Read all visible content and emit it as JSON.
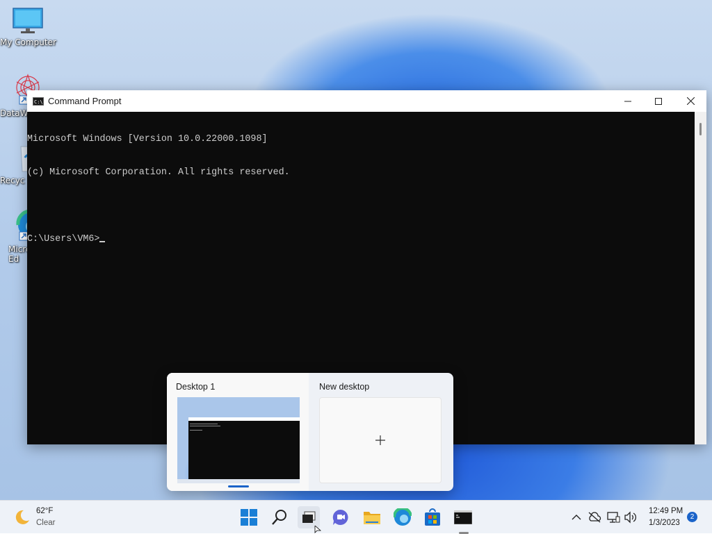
{
  "desktop": {
    "icons": [
      {
        "label": "My Computer",
        "icon": "monitor-icon"
      },
      {
        "label": "DataW",
        "icon": "datawatch-icon"
      },
      {
        "label": "Recyc",
        "icon": "recycle-bin-icon"
      },
      {
        "label": "Micro Ed",
        "icon": "edge-icon"
      }
    ]
  },
  "window": {
    "title": "Command Prompt",
    "buttons": [
      "minimize",
      "maximize",
      "close"
    ],
    "console_lines": [
      "Microsoft Windows [Version 10.0.22000.1098]",
      "(c) Microsoft Corporation. All rights reserved.",
      "",
      "C:\\Users\\VM6>"
    ]
  },
  "task_view": {
    "desktops": [
      {
        "label": "Desktop 1",
        "active": true
      },
      {
        "label": "New desktop",
        "icon": "plus-icon"
      }
    ]
  },
  "taskbar": {
    "weather": {
      "temp": "62°F",
      "condition": "Clear",
      "icon": "moon-icon"
    },
    "apps": [
      "start-icon",
      "search-icon",
      "task-view-icon",
      "teams-chat-icon",
      "file-explorer-icon",
      "edge-icon",
      "store-icon",
      "terminal-icon"
    ],
    "tray": [
      "chevron-up-icon",
      "cloud-off-icon",
      "network-icon",
      "volume-icon"
    ],
    "clock": {
      "time": "12:49 PM",
      "date": "1/3/2023"
    },
    "notification_count": "2"
  },
  "colors": {
    "accent": "#1a63c9",
    "console_bg": "#0c0c0c",
    "console_fg": "#cccccc"
  }
}
